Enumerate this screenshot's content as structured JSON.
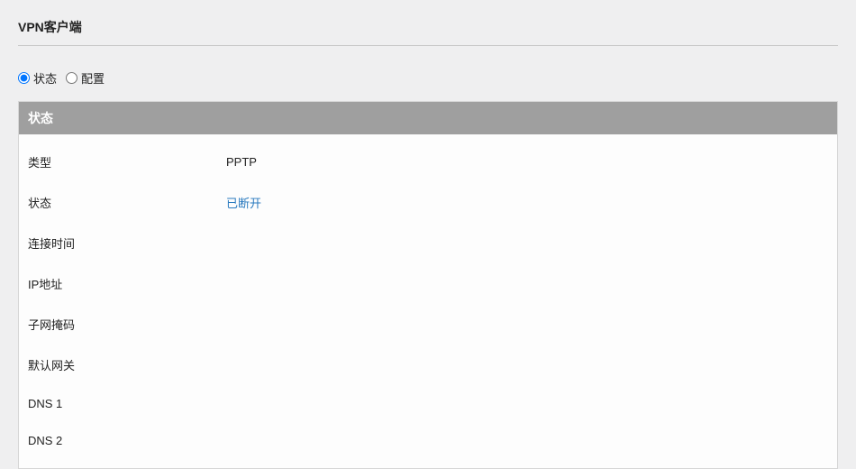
{
  "title": "VPN客户端",
  "tabs": {
    "status": "状态",
    "configure": "配置",
    "selected": "status"
  },
  "panel": {
    "header": "状态",
    "rows": [
      {
        "label": "类型",
        "value": "PPTP",
        "link": false
      },
      {
        "label": "状态",
        "value": "已断开",
        "link": true
      },
      {
        "label": "连接时间",
        "value": "",
        "link": false
      },
      {
        "label": "IP地址",
        "value": "",
        "link": false
      },
      {
        "label": "子网掩码",
        "value": "",
        "link": false
      },
      {
        "label": "默认网关",
        "value": "",
        "link": false
      },
      {
        "label": "DNS 1",
        "value": "",
        "link": false
      },
      {
        "label": "DNS 2",
        "value": "",
        "link": false
      }
    ]
  }
}
